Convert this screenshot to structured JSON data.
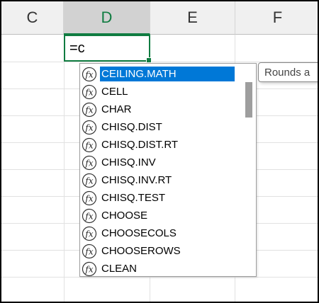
{
  "columns": [
    {
      "label": "C",
      "selected": false
    },
    {
      "label": "D",
      "selected": true
    },
    {
      "label": "E",
      "selected": false
    },
    {
      "label": "F",
      "selected": false
    }
  ],
  "active_cell": {
    "formula": "=c"
  },
  "autocomplete": {
    "icon": "function-fx-icon",
    "items": [
      {
        "label": "CEILING.MATH",
        "selected": true
      },
      {
        "label": "CELL",
        "selected": false
      },
      {
        "label": "CHAR",
        "selected": false
      },
      {
        "label": "CHISQ.DIST",
        "selected": false
      },
      {
        "label": "CHISQ.DIST.RT",
        "selected": false
      },
      {
        "label": "CHISQ.INV",
        "selected": false
      },
      {
        "label": "CHISQ.INV.RT",
        "selected": false
      },
      {
        "label": "CHISQ.TEST",
        "selected": false
      },
      {
        "label": "CHOOSE",
        "selected": false
      },
      {
        "label": "CHOOSECOLS",
        "selected": false
      },
      {
        "label": "CHOOSEROWS",
        "selected": false
      },
      {
        "label": "CLEAN",
        "selected": false
      }
    ]
  },
  "tooltip": {
    "text": "Rounds a"
  },
  "colors": {
    "accent": "#107c41",
    "selection": "#0078d7"
  }
}
